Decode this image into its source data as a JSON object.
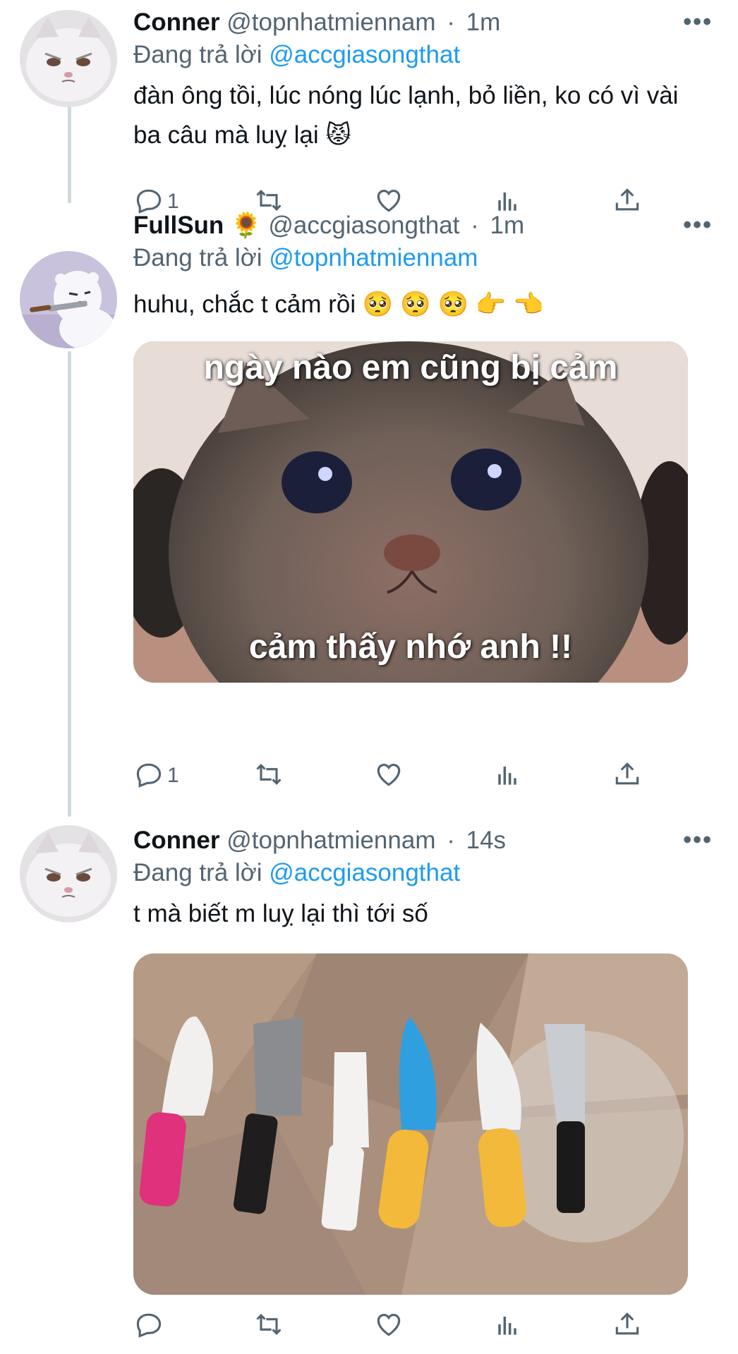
{
  "tweets": [
    {
      "name": "Conner",
      "handle": "@topnhatmiennam",
      "dot": "·",
      "time": "1m",
      "emoji": "",
      "reply_prefix": "Đang trả lời",
      "reply_to": "@accgiasongthat",
      "text": "đàn ông tồi, lúc nóng lúc lạnh, bỏ liền, ko có vì vài ba câu mà luỵ lại 😾",
      "reply_count": "1"
    },
    {
      "name": "FullSun",
      "handle": "@accgiasongthat",
      "dot": "·",
      "time": "1m",
      "emoji": "🌻",
      "reply_prefix": "Đang trả lời",
      "reply_to": "@topnhatmiennam",
      "text": "huhu, chắc t cảm rồi 🥺 🥺 🥺 👉 👈",
      "reply_count": "1",
      "media_caption_top": "ngày nào em cũng bị cảm",
      "media_caption_bottom": "cảm thấy nhớ anh !!"
    },
    {
      "name": "Conner",
      "handle": "@topnhatmiennam",
      "dot": "·",
      "time": "14s",
      "emoji": "",
      "reply_prefix": "Đang trả lời",
      "reply_to": "@accgiasongthat",
      "text": "t mà biết m luỵ lại thì tới số",
      "reply_count": ""
    }
  ],
  "more_label": "•••",
  "colors": {
    "link": "#1d9bf0",
    "muted": "#536471",
    "thread_line": "#cfd9de"
  }
}
